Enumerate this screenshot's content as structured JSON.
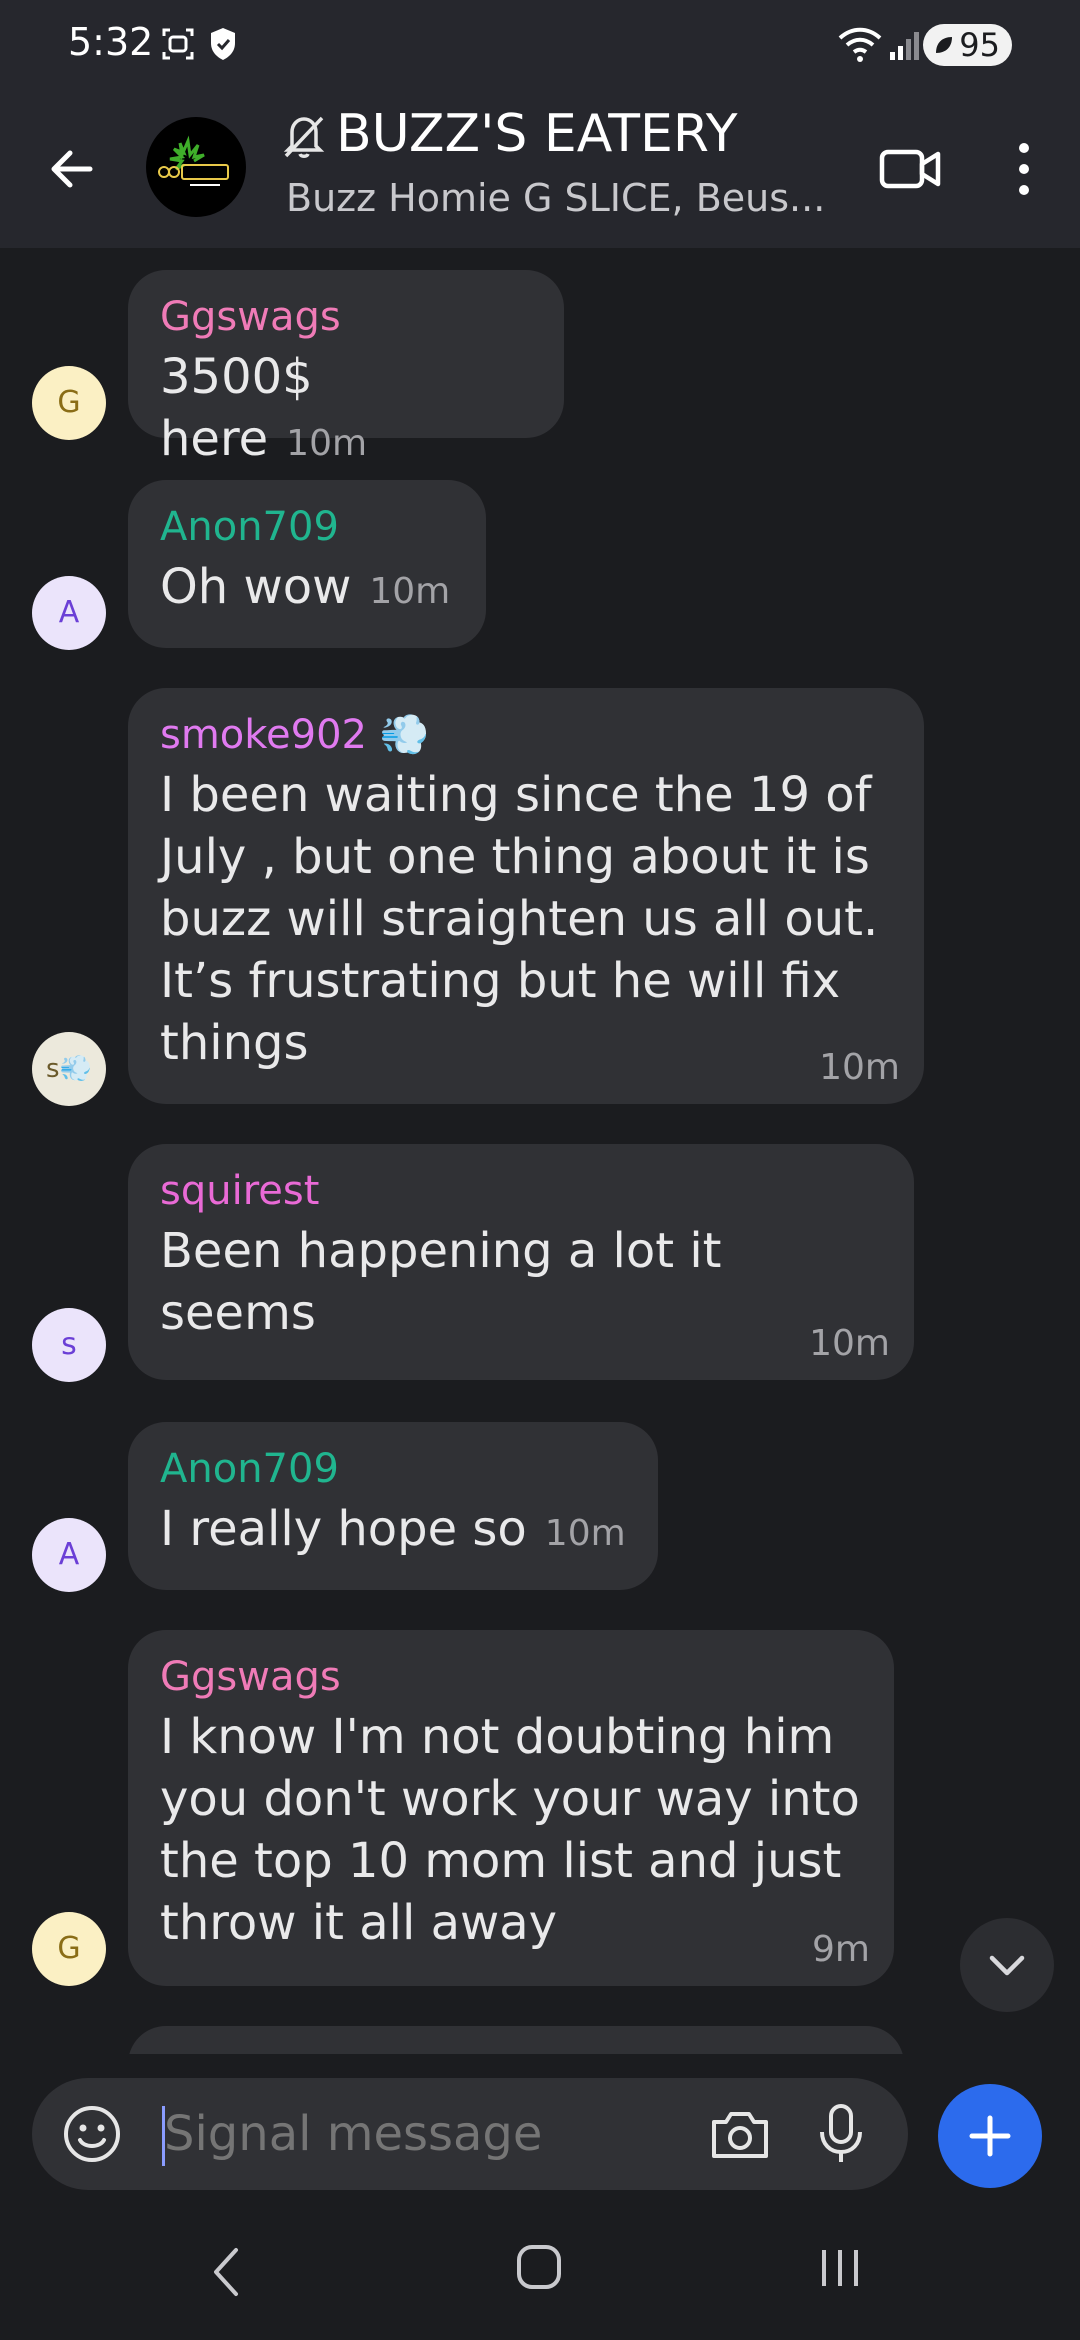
{
  "status_bar": {
    "time": "5:32",
    "battery": "95",
    "icons": [
      "screenshot-icon",
      "shield-icon",
      "wifi-icon",
      "signal-icon",
      "battery-saver-icon"
    ]
  },
  "header": {
    "title": "BUZZ'S EATERY",
    "members": "Buzz Homie G SLICE, Beus...",
    "muted": true
  },
  "messages": [
    {
      "sender": "Ggswags",
      "sender_color": "#ef7bb7",
      "avatar_letter": "G",
      "text": "3500$ here",
      "time": "10m"
    },
    {
      "sender": "Anon709",
      "sender_color": "#20b58f",
      "avatar_letter": "A",
      "text": "Oh wow",
      "time": "10m"
    },
    {
      "sender": "smoke902 💨",
      "sender_color": "#e07af0",
      "avatar_letter": "s💨",
      "text": "I been waiting since the 19 of July , but one thing about it is buzz will straighten us all out. It’s frustrating but he will fix things",
      "time": "10m"
    },
    {
      "sender": "squirest",
      "sender_color": "#e96ad6",
      "avatar_letter": "s",
      "text": "Been happening a lot it seems",
      "time": "10m"
    },
    {
      "sender": "Anon709",
      "sender_color": "#20b58f",
      "avatar_letter": "A",
      "text": "I really hope so",
      "time": "10m"
    },
    {
      "sender": "Ggswags",
      "sender_color": "#ef7bb7",
      "avatar_letter": "G",
      "text": "I know I'm not doubting him you don't work your way into the top 10 mom list and just throw it all away",
      "time": "9m"
    }
  ],
  "composer": {
    "placeholder": "Signal message"
  },
  "colors": {
    "background": "#1b1c1f",
    "bar": "#26272d",
    "bubble": "#303135",
    "accent": "#2c6bed"
  }
}
